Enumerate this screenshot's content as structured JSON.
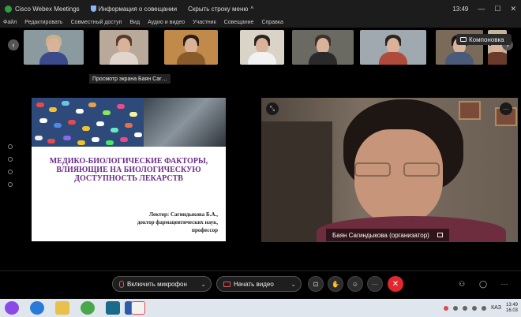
{
  "titlebar": {
    "app_name": "Cisco Webex Meetings",
    "meeting_info": "Информация о совещании",
    "hide_menu": "Скрыть строку меню",
    "hide_menu_chevron": "^",
    "time": "13:49",
    "minimize": "—",
    "maximize": "☐",
    "close": "✕"
  },
  "menu": [
    "Файл",
    "Редактировать",
    "Совместный доступ",
    "Вид",
    "Аудио и видео",
    "Участник",
    "Совещание",
    "Справка"
  ],
  "thumbnails": [
    {
      "bg": "#8a9a9e",
      "hair": "#c8b28a",
      "body": "#3a4a8a"
    },
    {
      "bg": "#b9a99a",
      "hair": "#5a3a28",
      "body": "#e0d6cc"
    },
    {
      "bg": "#c08a4a",
      "hair": "#2a1a14",
      "body": "#8a5a2a"
    },
    {
      "bg": "#dad4c8",
      "hair": "#2a2420",
      "body": "#f2f2f2"
    },
    {
      "bg": "#6a6a62",
      "hair": "#3a322a",
      "body": "#2a2a2a"
    },
    {
      "bg": "#a0a8b0",
      "hair": "#2a2420",
      "body": "#b04a3a"
    },
    {
      "bg": "#7a6a5a",
      "hair": "#1a1410",
      "body": "#4a5a7a"
    },
    {
      "bg": "#c4b49a",
      "hair": "#2a1e18",
      "body": "#6a3a2a"
    }
  ],
  "nav": {
    "prev": "‹",
    "next": "›"
  },
  "layout_button": "Компоновка",
  "tooltip": "Просмотр экрана Баян Саг…",
  "slide": {
    "title": "МЕДИКО-БИОЛОГИЧЕСКИЕ ФАКТОРЫ, ВЛИЯЮЩИЕ НА БИОЛОГИЧЕСКУЮ ДОСТУПНОСТЬ ЛЕКАРСТВ",
    "lecturer_line1": "Лектор:  Сагиндыкова Б.А.,",
    "lecturer_line2": "доктор фармацевтических наук,",
    "lecturer_line3": "профессор"
  },
  "speaker": {
    "name": "Баян Сагиндыкова (организатор)",
    "left_corner": "⤡",
    "right_corner": "···"
  },
  "controls": {
    "mic_label": "Включить микрофон",
    "video_label": "Начать видео",
    "chevron": "⌄",
    "share": "⊡",
    "hand": "✋",
    "reactions": "☺",
    "more": "···",
    "end": "✕",
    "participants": "⚇",
    "chat": "◯"
  },
  "taskbar": {
    "lang": "КАЗ",
    "time": "13:49",
    "date": "16.03"
  },
  "colors": {
    "accent_red": "#e0282e",
    "slide_title": "#6b2c8c"
  }
}
